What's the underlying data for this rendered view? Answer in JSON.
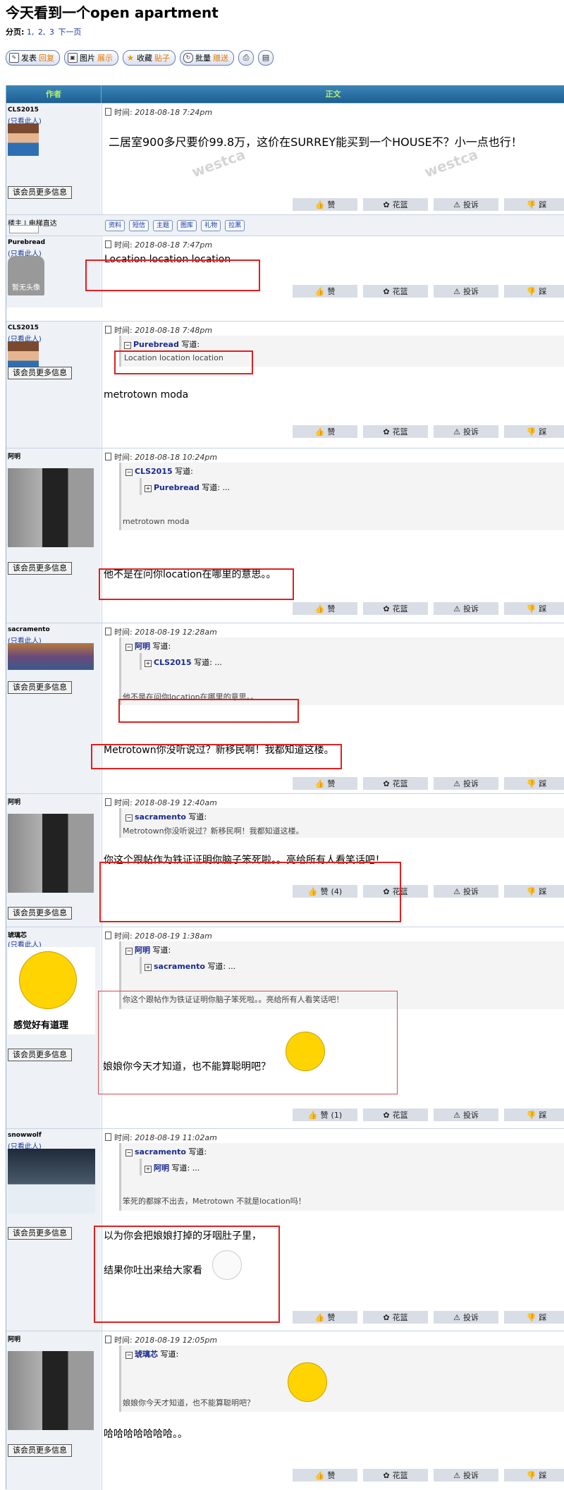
{
  "title": "今天看到一个open apartment",
  "pager": {
    "label": "分页:",
    "pages": [
      "1,",
      "2,",
      "3"
    ],
    "next": "下一页"
  },
  "toolbar": {
    "buttons": [
      {
        "a": "发表",
        "b": "回复"
      },
      {
        "a": "图片",
        "b": "展示"
      },
      {
        "a": "收藏",
        "b": "贴子"
      },
      {
        "a": "批量",
        "b": "赠送"
      }
    ]
  },
  "table": {
    "col_author": "作者",
    "col_body": "正文"
  },
  "common": {
    "only_this": "(只看此人)",
    "more_info": "该会员更多信息",
    "time_label": "时间:",
    "wrote": "写道:",
    "ellipsis": "...",
    "like": "赞",
    "flower": "花篮",
    "report": "投诉",
    "tread": "踩"
  },
  "signature": {
    "label": "楼主 | 电梯直达",
    "icons": [
      "资料",
      "短信",
      "主题",
      "图库",
      "礼物",
      "拉黑"
    ]
  },
  "watermark": "加西网",
  "posts": [
    {
      "author": "CLS2015",
      "time": "2018-08-18 7:24pm",
      "text": "二居室900多尺要价99.8万，这价在SURREY能买到一个HOUSE不？小一点也行！"
    },
    {
      "author": "Purebread",
      "time": "2018-08-18 7:47pm",
      "text": "Location location location",
      "avatar_text": "暂无头像"
    },
    {
      "author": "CLS2015",
      "time": "2018-08-18 7:48pm",
      "q1_author": "Purebread",
      "q1_text": "Location location location",
      "text": "metrotown moda"
    },
    {
      "author": "阿明",
      "time": "2018-08-18 10:24pm",
      "q1_author": "CLS2015",
      "q2_author": "Purebread",
      "q1_text": "metrotown moda",
      "text": "他不是在问你location在哪里的意思。。"
    },
    {
      "author": "sacramento",
      "time": "2018-08-19 12:28am",
      "q1_author": "阿明",
      "q2_author": "CLS2015",
      "q1_text": "他不是在问你location在哪里的意思。。",
      "text": "Metrotown你没听说过？新移民啊！我都知道这楼。"
    },
    {
      "author": "阿明",
      "time": "2018-08-19 12:40am",
      "q1_author": "sacramento",
      "q1_text": "Metrotown你没听说过？新移民啊！我都知道这楼。",
      "text": "你这个跟帖作为铁证证明你脑子笨死啦。。亮给所有人看笑话吧！",
      "likes": "(4)"
    },
    {
      "author": "琥璃芯",
      "time": "2018-08-19 1:38am",
      "avatar_text": "感觉好有道理",
      "q1_author": "阿明",
      "q2_author": "sacramento",
      "q1_text": "你这个跟帖作为铁证证明你脑子笨死啦。。亮给所有人看笑话吧！",
      "text": "娘娘你今天才知道，也不能算聪明吧？",
      "likes": "(1)"
    },
    {
      "author": "snowwolf",
      "time": "2018-08-19 11:02am",
      "q1_author": "sacramento",
      "q2_author": "阿明",
      "q1_text": "笨死的都嫁不出去，Metrotown 不就是location吗！",
      "line1": "以为你会把娘娘打掉的牙咽肚子里，",
      "line2": "结果你吐出来给大家看"
    },
    {
      "author": "阿明",
      "time": "2018-08-19 12:05pm",
      "q1_author": "琥璃芯",
      "q1_text": "娘娘你今天才知道，也不能算聪明吧？",
      "text": "哈哈哈哈哈哈哈。。"
    }
  ]
}
